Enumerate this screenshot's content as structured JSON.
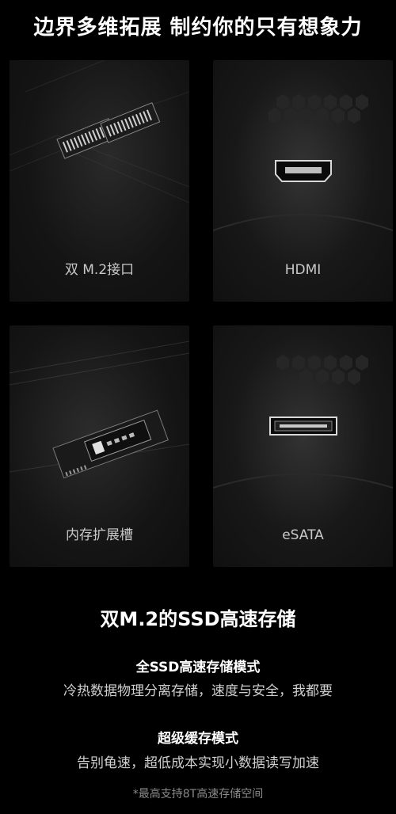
{
  "headline": "边界多维拓展 制约你的只有想象力",
  "cards": [
    {
      "label": "双 M.2接口",
      "icon": "m2-slot-icon"
    },
    {
      "label": "HDMI",
      "icon": "hdmi-port-icon"
    },
    {
      "label": "内存扩展槽",
      "icon": "memory-slot-icon"
    },
    {
      "label": "eSATA",
      "icon": "esata-port-icon"
    }
  ],
  "storage": {
    "title": "双M.2的SSD高速存储",
    "modes": [
      {
        "title": "全SSD高速存储模式",
        "description": "冷热数据物理分离存储，速度与安全，我都要"
      },
      {
        "title": "超级缓存模式",
        "description": "告别龟速，超低成本实现小数据读写加速"
      }
    ],
    "note": "*最高支持8T高速存储空间"
  },
  "colors": {
    "background": "#000000",
    "card": "#141414",
    "text": "#ffffff",
    "muted": "#8a8a8a"
  }
}
